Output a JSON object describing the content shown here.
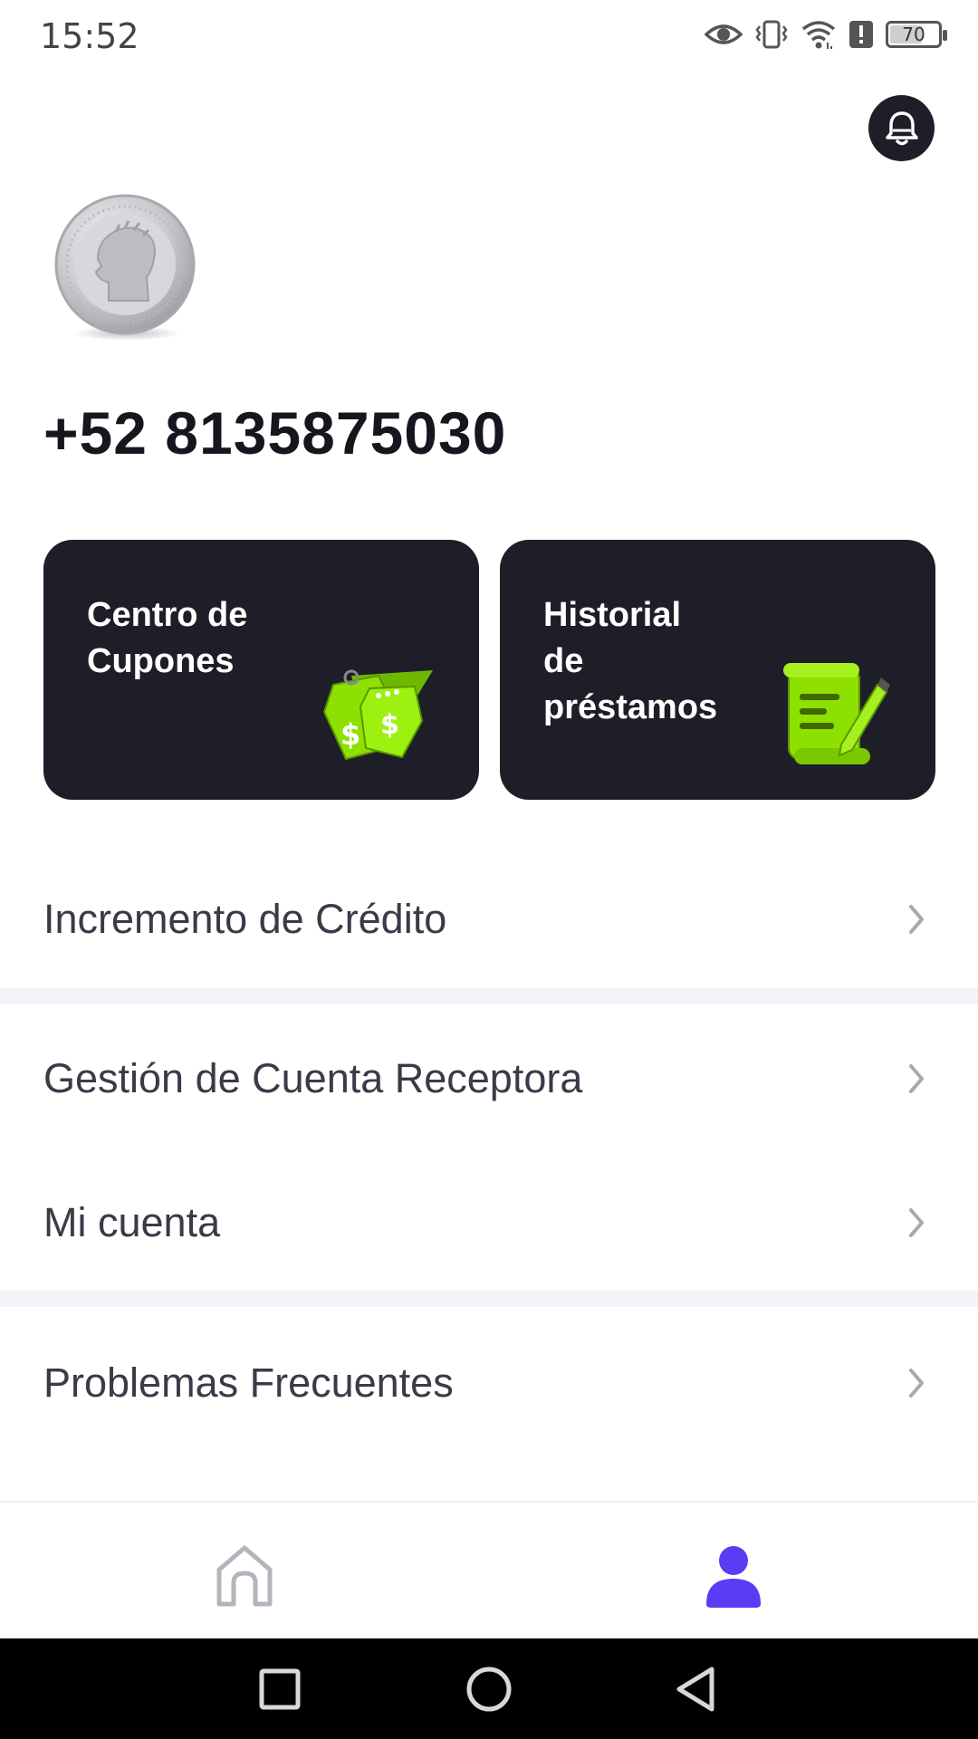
{
  "status_bar": {
    "time": "15:52",
    "battery": "70",
    "battery_level": 0.7,
    "icons": [
      "eye-icon",
      "vibrate-icon",
      "wifi-icon",
      "alert-icon",
      "battery-icon"
    ]
  },
  "header": {
    "bell_icon": "bell-icon"
  },
  "profile": {
    "avatar_icon": "coin-avatar",
    "phone": "+52 8135875030"
  },
  "cards": [
    {
      "title": "Centro de\nCupones",
      "icon": "coupon-tags-icon"
    },
    {
      "title": "Historial\nde\npréstamos",
      "icon": "scroll-pencil-icon"
    }
  ],
  "menu": {
    "items": [
      {
        "label": "Incremento de Crédito"
      },
      {
        "label": "Gestión de Cuenta Receptora"
      },
      {
        "label": "Mi cuenta"
      },
      {
        "label": "Problemas Frecuentes"
      }
    ]
  },
  "bottom_nav": {
    "items": [
      {
        "icon": "home-icon",
        "active": false
      },
      {
        "icon": "profile-icon",
        "active": true
      }
    ],
    "active_color": "#5a3cf5",
    "inactive_color": "#b4b4bc"
  },
  "colors": {
    "card_bg": "#1e1e28",
    "accent_green": "#8ee000",
    "divider": "#f3f3fa"
  }
}
